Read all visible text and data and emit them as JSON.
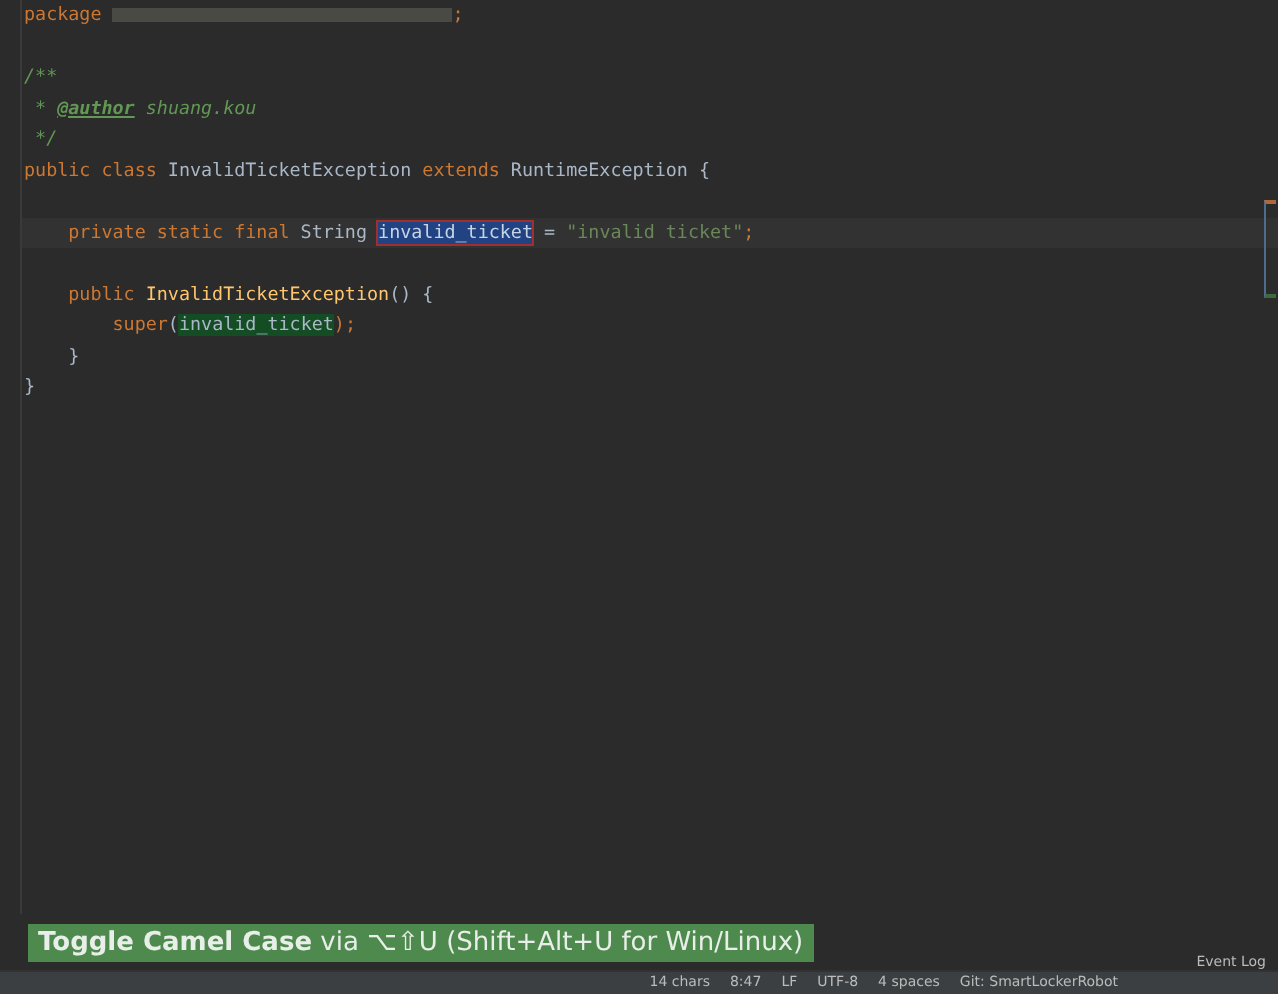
{
  "editor": {
    "lines": [
      {
        "tokens": [
          {
            "text": "package ",
            "kind": "keyword"
          },
          {
            "kind": "blurred"
          },
          {
            "text": ";",
            "kind": "keyword"
          }
        ]
      },
      {
        "kind": "blank"
      },
      {
        "tokens": [
          {
            "text": "/**",
            "kind": "doc"
          }
        ]
      },
      {
        "tokens": [
          {
            "text": " * ",
            "kind": "doc"
          },
          {
            "text": "@author",
            "kind": "doctag"
          },
          {
            "text": " shuang.kou",
            "kind": "doc"
          }
        ]
      },
      {
        "tokens": [
          {
            "text": " */",
            "kind": "doc"
          }
        ]
      },
      {
        "tokens": [
          {
            "text": "public class ",
            "kind": "keyword"
          },
          {
            "text": "InvalidTicketException ",
            "kind": "plain"
          },
          {
            "text": "extends ",
            "kind": "keyword"
          },
          {
            "text": "RuntimeException {",
            "kind": "plain"
          }
        ]
      },
      {
        "kind": "blank"
      },
      {
        "current": true,
        "tokens": [
          {
            "text": "    private static final ",
            "kind": "keyword"
          },
          {
            "text": "String ",
            "kind": "plain"
          },
          {
            "text": "invalid_ticket",
            "kind": "selection"
          },
          {
            "text": " = ",
            "kind": "plain"
          },
          {
            "text": "\"invalid ticket\"",
            "kind": "string"
          },
          {
            "text": ";",
            "kind": "keyword"
          }
        ]
      },
      {
        "kind": "blank"
      },
      {
        "tokens": [
          {
            "text": "    public ",
            "kind": "keyword"
          },
          {
            "text": "InvalidTicketException",
            "kind": "method"
          },
          {
            "text": "() {",
            "kind": "plain"
          }
        ]
      },
      {
        "tokens": [
          {
            "text": "        super",
            "kind": "keyword"
          },
          {
            "text": "(",
            "kind": "plain"
          },
          {
            "text": "invalid_ticket",
            "kind": "usage"
          },
          {
            "text": ");",
            "kind": "keyword"
          }
        ]
      },
      {
        "tokens": [
          {
            "text": "    }",
            "kind": "plain"
          }
        ]
      },
      {
        "tokens": [
          {
            "text": "}",
            "kind": "plain"
          }
        ]
      }
    ]
  },
  "caption": {
    "bold": "Toggle Camel Case",
    "rest": "via ⌥⇧U (Shift+Alt+U for Win/Linux)"
  },
  "event_log": "Event Log",
  "status_bar": [
    "14 chars",
    "8:47",
    "LF",
    "UTF-8",
    "4 spaces",
    "Git: SmartLockerRobot"
  ]
}
